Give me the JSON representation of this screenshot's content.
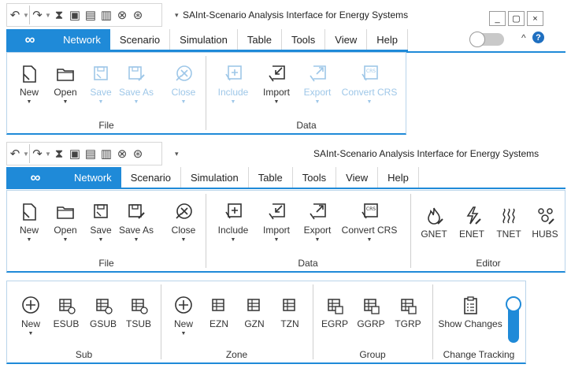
{
  "colors": {
    "accent": "#1f8ad8",
    "disabled": "#9ec7e8"
  },
  "window1": {
    "title": "SAInt-Scenario Analysis Interface for Energy Systems",
    "window_controls": [
      "_",
      "▢",
      "×"
    ],
    "help_glyph": "?",
    "collapse_glyph": "^",
    "tabs": [
      "Network",
      "Scenario",
      "Simulation",
      "Table",
      "Tools",
      "View",
      "Help"
    ],
    "groups": {
      "file": "File",
      "data": "Data"
    },
    "file_buttons": [
      {
        "label": "New",
        "icon": "new-icon",
        "enabled": true
      },
      {
        "label": "Open",
        "icon": "open-folder-icon",
        "enabled": true
      },
      {
        "label": "Save",
        "icon": "save-icon",
        "enabled": false
      },
      {
        "label": "Save As",
        "icon": "save-as-icon",
        "enabled": false
      },
      {
        "label": "Close",
        "icon": "close-network-icon",
        "enabled": false
      }
    ],
    "data_buttons": [
      {
        "label": "Include",
        "icon": "include-icon",
        "enabled": false
      },
      {
        "label": "Import",
        "icon": "import-icon",
        "enabled": true
      },
      {
        "label": "Export",
        "icon": "export-icon",
        "enabled": false
      },
      {
        "label": "Convert CRS",
        "icon": "convert-crs-icon",
        "enabled": false
      }
    ]
  },
  "window2": {
    "title": "SAInt-Scenario Analysis Interface for Energy Systems",
    "tabs": [
      "Network",
      "Scenario",
      "Simulation",
      "Table",
      "Tools",
      "View",
      "Help"
    ],
    "groups": {
      "file": "File",
      "data": "Data",
      "editor": "Editor"
    },
    "file_buttons": [
      {
        "label": "New",
        "icon": "new-icon"
      },
      {
        "label": "Open",
        "icon": "open-folder-icon"
      },
      {
        "label": "Save",
        "icon": "save-icon"
      },
      {
        "label": "Save As",
        "icon": "save-as-icon"
      },
      {
        "label": "Close",
        "icon": "close-network-icon"
      }
    ],
    "data_buttons": [
      {
        "label": "Include",
        "icon": "include-icon"
      },
      {
        "label": "Import",
        "icon": "import-icon"
      },
      {
        "label": "Export",
        "icon": "export-icon"
      },
      {
        "label": "Convert CRS",
        "icon": "convert-crs-icon"
      }
    ],
    "editor_buttons": [
      {
        "label": "GNET",
        "icon": "gas-network-icon"
      },
      {
        "label": "ENET",
        "icon": "electric-network-icon"
      },
      {
        "label": "TNET",
        "icon": "thermal-network-icon"
      },
      {
        "label": "HUBS",
        "icon": "hubs-icon"
      }
    ]
  },
  "panel3": {
    "groups": {
      "sub": "Sub",
      "zone": "Zone",
      "group": "Group",
      "tracking": "Change Tracking"
    },
    "sub_buttons": [
      {
        "label": "New",
        "icon": "add-circle-icon"
      },
      {
        "label": "ESUB",
        "icon": "esub-icon"
      },
      {
        "label": "GSUB",
        "icon": "gsub-icon"
      },
      {
        "label": "TSUB",
        "icon": "tsub-icon"
      }
    ],
    "zone_buttons": [
      {
        "label": "New",
        "icon": "add-circle-icon"
      },
      {
        "label": "EZN",
        "icon": "ezn-icon"
      },
      {
        "label": "GZN",
        "icon": "gzn-icon"
      },
      {
        "label": "TZN",
        "icon": "tzn-icon"
      }
    ],
    "group_buttons": [
      {
        "label": "EGRP",
        "icon": "egrp-icon"
      },
      {
        "label": "GGRP",
        "icon": "ggrp-icon"
      },
      {
        "label": "TGRP",
        "icon": "tgrp-icon"
      }
    ],
    "tracking_buttons": [
      {
        "label": "Show Changes",
        "icon": "clipboard-checklist-icon"
      }
    ]
  },
  "qat_arrow": "▼",
  "more_glyph": "▾"
}
